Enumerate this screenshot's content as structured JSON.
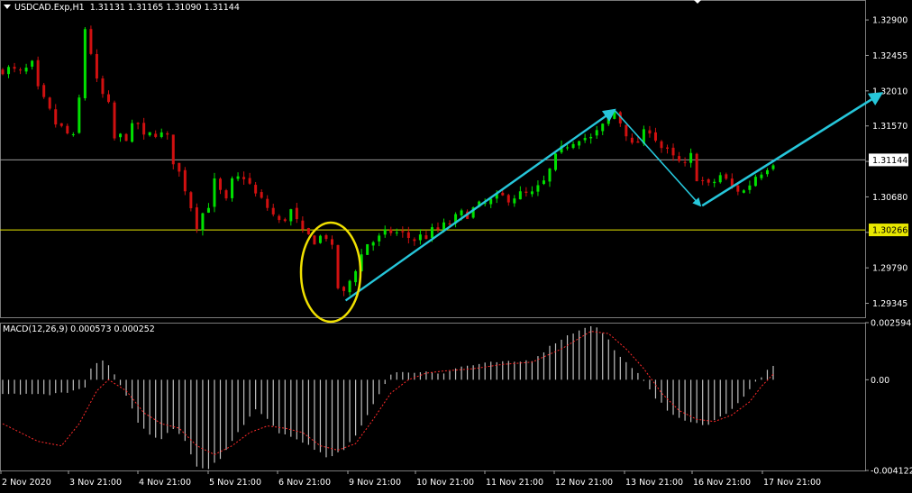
{
  "header": {
    "symbol": "USDCAD.Exp,H1",
    "ohlc": "1.31131 1.31165 1.31090 1.31144"
  },
  "macd_header": "MACD(12,26,9) 0.000573 0.000252",
  "colors": {
    "background": "#000000",
    "bull": "#00e000",
    "bear": "#d01010",
    "price_line": "#9a9a9a",
    "support_line": "#e8e800",
    "arrow": "#26c6da",
    "circle": "#f0e000",
    "macd_hist": "#c0c0c0",
    "macd_signal": "#ff2a2a",
    "axis": "#a0a0a0"
  },
  "chart_data": [
    {
      "type": "candlestick",
      "panel": "price",
      "y_ticks": [
        "1.32900",
        "1.32455",
        "1.32010",
        "1.31570",
        "1.31125",
        "1.30680",
        "1.30235",
        "1.29790",
        "1.29345"
      ],
      "ylim": [
        1.2917,
        1.3315
      ],
      "current_price_label": "1.31144",
      "current_price": 1.31144,
      "support_label": "1.30266",
      "support_level": 1.30266,
      "x_labels": [
        "2 Nov 2020",
        "3 Nov 21:00",
        "4 Nov 21:00",
        "5 Nov 21:00",
        "6 Nov 21:00",
        "9 Nov 21:00",
        "10 Nov 21:00",
        "11 Nov 21:00",
        "12 Nov 21:00",
        "13 Nov 21:00",
        "16 Nov 21:00",
        "17 Nov 21:00"
      ],
      "candle_count": 132,
      "price_path": [
        [
          0,
          1.323
        ],
        [
          3,
          1.3222
        ],
        [
          5,
          1.3232
        ],
        [
          6,
          1.32
        ],
        [
          9,
          1.316
        ],
        [
          12,
          1.314
        ],
        [
          13,
          1.319
        ],
        [
          14,
          1.328
        ],
        [
          15,
          1.325
        ],
        [
          16,
          1.321
        ],
        [
          18,
          1.318
        ],
        [
          19,
          1.314
        ],
        [
          21,
          1.3145
        ],
        [
          23,
          1.316
        ],
        [
          24,
          1.314
        ],
        [
          26,
          1.315
        ],
        [
          28,
          1.314
        ],
        [
          29,
          1.3115
        ],
        [
          31,
          1.308
        ],
        [
          33,
          1.3035
        ],
        [
          35,
          1.306
        ],
        [
          36,
          1.3085
        ],
        [
          38,
          1.306
        ],
        [
          39,
          1.3085
        ],
        [
          41,
          1.3095
        ],
        [
          43,
          1.307
        ],
        [
          45,
          1.3055
        ],
        [
          47,
          1.3035
        ],
        [
          49,
          1.305
        ],
        [
          51,
          1.302
        ],
        [
          53,
          1.3015
        ],
        [
          55,
          1.302
        ],
        [
          56,
          1.3
        ],
        [
          57,
          1.2955
        ],
        [
          58,
          1.2945
        ],
        [
          60,
          1.298
        ],
        [
          62,
          1.301
        ],
        [
          64,
          1.3015
        ],
        [
          66,
          1.3025
        ],
        [
          68,
          1.302
        ],
        [
          70,
          1.3015
        ],
        [
          72,
          1.302
        ],
        [
          75,
          1.303
        ],
        [
          78,
          1.3045
        ],
        [
          81,
          1.3055
        ],
        [
          84,
          1.3065
        ],
        [
          87,
          1.307
        ],
        [
          90,
          1.307
        ],
        [
          92,
          1.3085
        ],
        [
          94,
          1.3115
        ],
        [
          96,
          1.3135
        ],
        [
          98,
          1.3145
        ],
        [
          100,
          1.314
        ],
        [
          102,
          1.3155
        ],
        [
          104,
          1.3175
        ],
        [
          106,
          1.315
        ],
        [
          107,
          1.313
        ],
        [
          109,
          1.3145
        ],
        [
          110,
          1.3155
        ],
        [
          112,
          1.313
        ],
        [
          114,
          1.3115
        ],
        [
          116,
          1.3105
        ],
        [
          117,
          1.3118
        ],
        [
          118,
          1.3095
        ],
        [
          120,
          1.308
        ],
        [
          122,
          1.3095
        ],
        [
          124,
          1.308
        ],
        [
          126,
          1.3075
        ],
        [
          127,
          1.3085
        ],
        [
          128,
          1.3095
        ],
        [
          130,
          1.3108
        ],
        [
          131,
          1.3114
        ]
      ]
    },
    {
      "type": "bar",
      "panel": "MACD(12,26,9)",
      "y_ticks": [
        "0.002594",
        "0.00",
        "-0.004122"
      ],
      "ylim": [
        -0.004122,
        0.002594
      ],
      "histogram_path": [
        [
          0,
          -0.0006
        ],
        [
          8,
          -0.0007
        ],
        [
          14,
          -0.0004
        ],
        [
          15,
          0.0005
        ],
        [
          17,
          0.0009
        ],
        [
          19,
          0.0003
        ],
        [
          21,
          -0.0007
        ],
        [
          23,
          -0.002
        ],
        [
          25,
          -0.0025
        ],
        [
          27,
          -0.0027
        ],
        [
          29,
          -0.0022
        ],
        [
          31,
          -0.0028
        ],
        [
          33,
          -0.004
        ],
        [
          35,
          -0.004
        ],
        [
          37,
          -0.0036
        ],
        [
          39,
          -0.0028
        ],
        [
          41,
          -0.002
        ],
        [
          43,
          -0.0014
        ],
        [
          45,
          -0.0018
        ],
        [
          47,
          -0.0024
        ],
        [
          49,
          -0.0026
        ],
        [
          51,
          -0.0028
        ],
        [
          53,
          -0.0032
        ],
        [
          55,
          -0.0035
        ],
        [
          56,
          -0.0035
        ],
        [
          58,
          -0.0032
        ],
        [
          60,
          -0.0025
        ],
        [
          62,
          -0.0016
        ],
        [
          64,
          -0.0006
        ],
        [
          66,
          0.0002
        ],
        [
          68,
          0.0004
        ],
        [
          70,
          0.0003
        ],
        [
          72,
          0.0004
        ],
        [
          75,
          0.0003
        ],
        [
          78,
          0.0006
        ],
        [
          81,
          0.0007
        ],
        [
          84,
          0.0008
        ],
        [
          87,
          0.0008
        ],
        [
          90,
          0.0009
        ],
        [
          92,
          0.0013
        ],
        [
          94,
          0.0017
        ],
        [
          96,
          0.002
        ],
        [
          99,
          0.0024
        ],
        [
          101,
          0.0024
        ],
        [
          103,
          0.0018
        ],
        [
          105,
          0.001
        ],
        [
          107,
          0.0005
        ],
        [
          109,
          0.0
        ],
        [
          111,
          -0.0008
        ],
        [
          113,
          -0.0014
        ],
        [
          116,
          -0.0019
        ],
        [
          118,
          -0.002
        ],
        [
          120,
          -0.002
        ],
        [
          122,
          -0.0017
        ],
        [
          124,
          -0.0013
        ],
        [
          126,
          -0.0008
        ],
        [
          128,
          -0.0001
        ],
        [
          130,
          0.0004
        ],
        [
          131,
          0.00057
        ]
      ],
      "signal_path": [
        [
          0,
          -0.002
        ],
        [
          6,
          -0.0028
        ],
        [
          10,
          -0.003
        ],
        [
          13,
          -0.002
        ],
        [
          16,
          -0.0005
        ],
        [
          18,
          0.0
        ],
        [
          21,
          -0.0005
        ],
        [
          24,
          -0.0015
        ],
        [
          27,
          -0.002
        ],
        [
          30,
          -0.0022
        ],
        [
          33,
          -0.003
        ],
        [
          36,
          -0.0034
        ],
        [
          39,
          -0.003
        ],
        [
          42,
          -0.0024
        ],
        [
          45,
          -0.0021
        ],
        [
          48,
          -0.0022
        ],
        [
          51,
          -0.0024
        ],
        [
          54,
          -0.003
        ],
        [
          57,
          -0.0032
        ],
        [
          60,
          -0.0029
        ],
        [
          63,
          -0.0018
        ],
        [
          66,
          -0.0006
        ],
        [
          69,
          0.0
        ],
        [
          72,
          0.0003
        ],
        [
          75,
          0.0004
        ],
        [
          80,
          0.0005
        ],
        [
          85,
          0.0007
        ],
        [
          90,
          0.0008
        ],
        [
          95,
          0.0014
        ],
        [
          100,
          0.0022
        ],
        [
          103,
          0.0021
        ],
        [
          106,
          0.0014
        ],
        [
          109,
          0.0005
        ],
        [
          112,
          -0.0006
        ],
        [
          115,
          -0.0014
        ],
        [
          118,
          -0.0018
        ],
        [
          121,
          -0.0019
        ],
        [
          124,
          -0.0016
        ],
        [
          127,
          -0.001
        ],
        [
          129,
          -0.0003
        ],
        [
          131,
          0.000252
        ]
      ]
    }
  ]
}
